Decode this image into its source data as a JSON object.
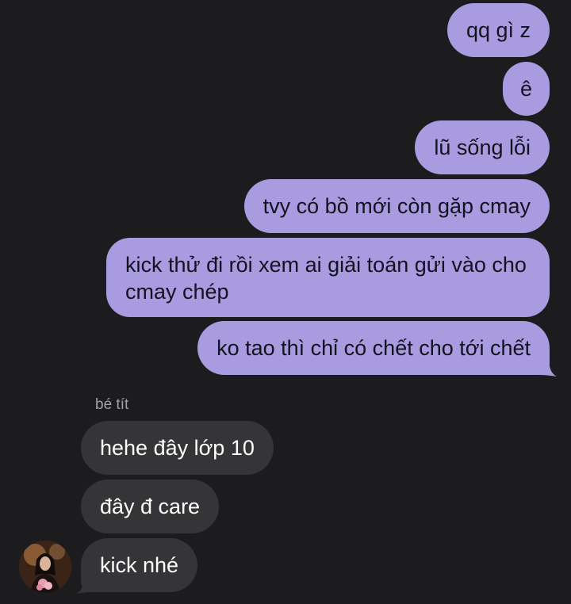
{
  "messages_sent": [
    {
      "text": "qq gì z"
    },
    {
      "text": "ê"
    },
    {
      "text": "lũ sống lỗi"
    },
    {
      "text": "tvy có bồ mới còn gặp cmay"
    },
    {
      "text": "kick thử đi rồi xem ai giải toán gửi vào cho cmay chép"
    },
    {
      "text": "ko tao thì chỉ có chết cho tới chết"
    }
  ],
  "received": {
    "sender_name": "bé tít",
    "messages": [
      {
        "text": "hehe đây lớp 10"
      },
      {
        "text": "đây đ care"
      },
      {
        "text": "kick nhé"
      }
    ]
  },
  "colors": {
    "background": "#1c1c1e",
    "outgoing_bubble": "#a99be0",
    "incoming_bubble": "#353537",
    "sender_label": "#a1a1a6"
  }
}
